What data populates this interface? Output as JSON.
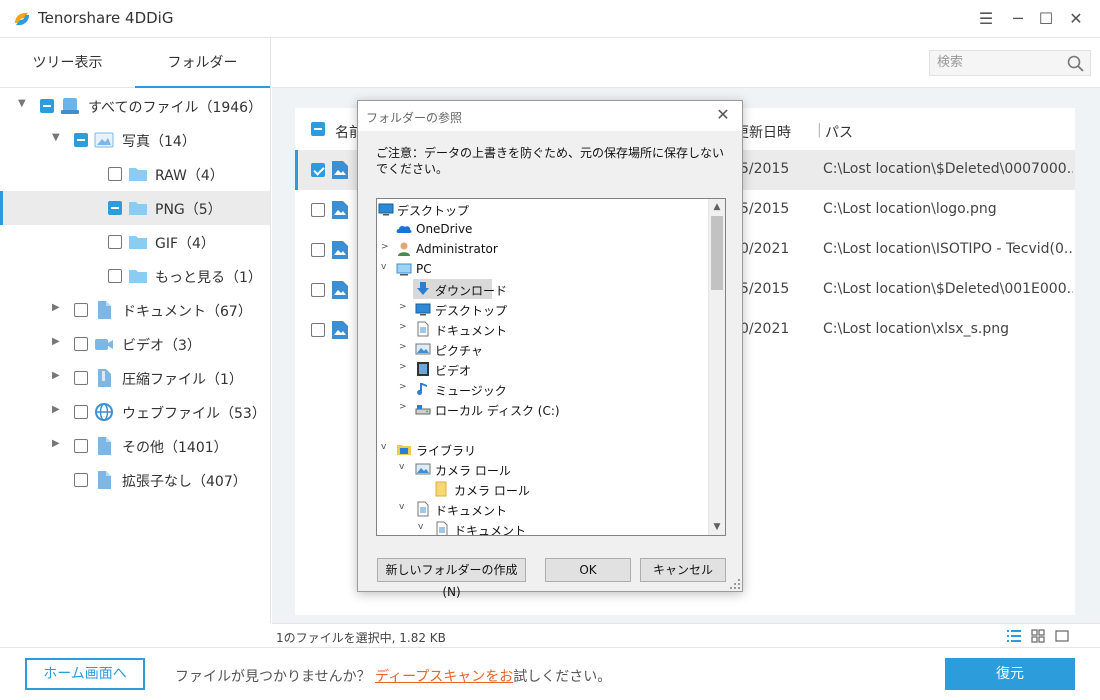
{
  "app": {
    "title": "Tenorshare 4DDiG",
    "logo_icon": "4ddig-logo-icon"
  },
  "window_controls": {
    "menu": "☰",
    "minimize": "─",
    "maximize": "☐",
    "close": "✕"
  },
  "sidebar": {
    "tabs": [
      {
        "label": "ツリー表示",
        "active": false
      },
      {
        "label": "フォルダー",
        "active": true
      }
    ],
    "tree": [
      {
        "label": "すべてのファイル（1946）",
        "state": "partial",
        "expanded": true,
        "icon": "drive-icon"
      },
      {
        "label": "写真（14）",
        "state": "partial",
        "expanded": true,
        "icon": "image-icon"
      },
      {
        "label": "RAW（4）",
        "state": "unchecked",
        "icon": "folder-icon"
      },
      {
        "label": "PNG（5）",
        "state": "partial",
        "icon": "folder-icon",
        "selected": true
      },
      {
        "label": "GIF（4）",
        "state": "unchecked",
        "icon": "folder-icon"
      },
      {
        "label": "もっと見る（1）",
        "state": "unchecked",
        "icon": "folder-icon"
      },
      {
        "label": "ドキュメント（67）",
        "state": "unchecked",
        "expanded": false,
        "icon": "document-icon"
      },
      {
        "label": "ビデオ（3）",
        "state": "unchecked",
        "expanded": false,
        "icon": "video-icon"
      },
      {
        "label": "圧縮ファイル（1）",
        "state": "unchecked",
        "expanded": false,
        "icon": "archive-icon"
      },
      {
        "label": "ウェブファイル（53）",
        "state": "unchecked",
        "expanded": false,
        "icon": "globe-icon"
      },
      {
        "label": "その他（1401）",
        "state": "unchecked",
        "expanded": false,
        "icon": "file-icon"
      },
      {
        "label": "拡張子なし（407）",
        "state": "unchecked",
        "icon": "file-icon"
      }
    ]
  },
  "main": {
    "search_placeholder": "検索",
    "columns": {
      "name": "名前",
      "modified": "更新日時",
      "path": "パス"
    },
    "rows": [
      {
        "date": "5/2015",
        "path": "C:\\Lost location\\$Deleted\\0007000...",
        "checked": true
      },
      {
        "date": "5/2015",
        "path": "C:\\Lost location\\logo.png",
        "checked": false
      },
      {
        "date": "0/2021",
        "path": "C:\\Lost location\\ISOTIPO - Tecvid(0...",
        "checked": false
      },
      {
        "date": "5/2015",
        "path": "C:\\Lost location\\$Deleted\\001E000...",
        "checked": false
      },
      {
        "date": "0/2021",
        "path": "C:\\Lost location\\xlsx_s.png",
        "checked": false
      }
    ]
  },
  "status": {
    "text": "1のファイルを選択中, 1.82 KB",
    "views": [
      "list-view-icon",
      "grid-view-icon",
      "preview-view-icon"
    ]
  },
  "footer": {
    "home_label": "ホーム画面へ",
    "prompt_prefix": "ファイルが見つかりませんか？",
    "deep_scan_link": "ディープスキャンをお",
    "prompt_suffix": "試しください。",
    "recover_label": "復元"
  },
  "dialog": {
    "title": "フォルダーの参照",
    "note": "ご注意：データの上書きを防ぐため、元の保存場所に保存しないでください。",
    "tree": [
      {
        "label": "デスクトップ",
        "icon": "desktop-icon",
        "arrow": ""
      },
      {
        "label": "OneDrive",
        "icon": "onedrive-icon",
        "arrow": ""
      },
      {
        "label": "Administrator",
        "icon": "user-icon",
        "arrow": ">"
      },
      {
        "label": "PC",
        "icon": "pc-icon",
        "arrow": "v"
      },
      {
        "label": "ダウンロード",
        "icon": "download-icon",
        "arrow": "",
        "selected": true
      },
      {
        "label": "デスクトップ",
        "icon": "desktop-icon",
        "arrow": ">"
      },
      {
        "label": "ドキュメント",
        "icon": "document-icon",
        "arrow": ">"
      },
      {
        "label": "ピクチャ",
        "icon": "pictures-icon",
        "arrow": ">"
      },
      {
        "label": "ビデオ",
        "icon": "video-icon",
        "arrow": ">"
      },
      {
        "label": "ミュージック",
        "icon": "music-icon",
        "arrow": ">"
      },
      {
        "label": "ローカル ディスク (C:)",
        "icon": "disk-icon",
        "arrow": ">"
      },
      {
        "label": "ライブラリ",
        "icon": "library-icon",
        "arrow": "v"
      },
      {
        "label": "カメラ ロール",
        "icon": "pictures-icon",
        "arrow": "v"
      },
      {
        "label": "カメラ ロール",
        "icon": "folder-icon",
        "arrow": ""
      },
      {
        "label": "ドキュメント",
        "icon": "document-icon",
        "arrow": "v"
      },
      {
        "label": "ドキュメント",
        "icon": "document-icon",
        "arrow": "v"
      }
    ],
    "buttons": {
      "new_folder": "新しいフォルダーの作成(N)",
      "ok": "OK",
      "cancel": "キャンセル"
    }
  },
  "colors": {
    "accent": "#2d9cdb",
    "link": "#e8642a",
    "selected_bg": "#ebebeb"
  }
}
